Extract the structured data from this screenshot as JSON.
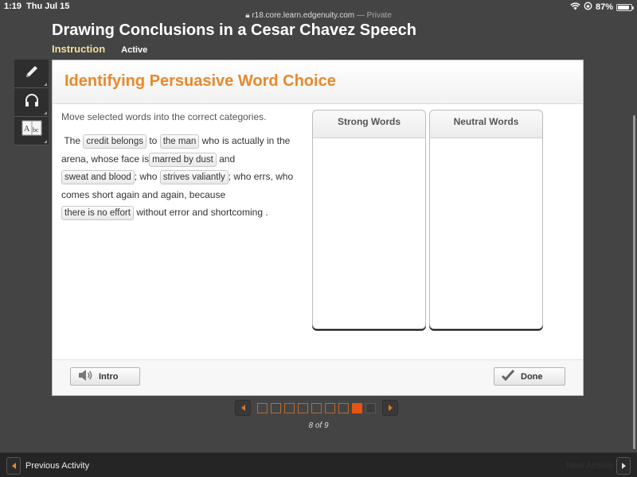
{
  "status_bar": {
    "time": "1:19",
    "date": "Thu Jul 15",
    "battery": "87%",
    "battery_level": 0.87
  },
  "browser": {
    "url": "r18.core.learn.edgenuity.com",
    "mode": "— Private"
  },
  "course": {
    "title": "Drawing Conclusions in a Cesar Chavez Speech",
    "section": "Instruction",
    "status": "Active"
  },
  "tools": [
    {
      "icon": "pencil-icon",
      "glyph": "✎"
    },
    {
      "icon": "headphones-icon",
      "glyph": "🎧"
    },
    {
      "icon": "dictionary-icon",
      "glyph": "Abc"
    }
  ],
  "activity": {
    "title": "Identifying Persuasive Word Choice",
    "instructions": "Move selected words into the correct categories.",
    "passage": {
      "t0": "The",
      "c1": "credit belongs",
      "t1": "to",
      "c2": "the man",
      "t2": "who is actually in the arena, whose face is",
      "c3": "marred by dust",
      "t3": "and",
      "c4": "sweat and blood",
      "t4": "; who",
      "c5": "strives valiantly",
      "t5": "; who errs, who comes short again and again, because",
      "c6": "there is no effort",
      "t6": "without error and shortcoming ."
    },
    "bins": [
      {
        "label": "Strong Words",
        "items": []
      },
      {
        "label": "Neutral Words",
        "items": []
      }
    ],
    "buttons": {
      "intro": "Intro",
      "done": "Done"
    }
  },
  "pagination": {
    "current": 8,
    "total": 9,
    "label": "8 of 9"
  },
  "bottom_nav": {
    "previous": "Previous Activity",
    "next": "Next Activity"
  },
  "colors": {
    "accent": "#e8892a",
    "current_page": "#e8530f",
    "section": "#f2dfa2"
  }
}
